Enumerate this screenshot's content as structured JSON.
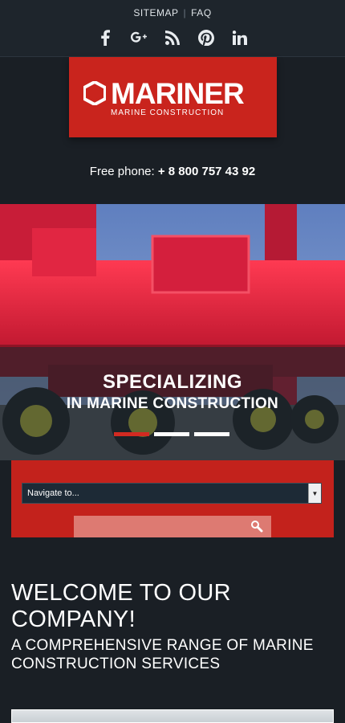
{
  "top_nav": {
    "sitemap": "SITEMAP",
    "separator": "|",
    "faq": "FAQ"
  },
  "social": [
    "facebook-icon",
    "google-plus-icon",
    "rss-icon",
    "pinterest-icon",
    "linkedin-icon"
  ],
  "logo": {
    "name": "MARINER",
    "subtitle": "MARINE CONSTRUCTION"
  },
  "phone": {
    "label": "Free phone:",
    "number": "+ 8 800 757 43 92"
  },
  "hero": {
    "caption_line1": "SPECIALIZING",
    "caption_line2": "IN MARINE CONSTRUCTION",
    "slides": 3,
    "active_slide": 1
  },
  "navigation": {
    "select_value": "Navigate to..."
  },
  "search": {
    "placeholder": ""
  },
  "welcome": {
    "title": "WELCOME TO OUR COMPANY!",
    "subtitle": "A COMPREHENSIVE RANGE OF MARINE CONSTRUCTION SERVICES"
  },
  "colors": {
    "accent": "#c9241d",
    "background": "#1a1f25",
    "panel": "#c3221c"
  }
}
